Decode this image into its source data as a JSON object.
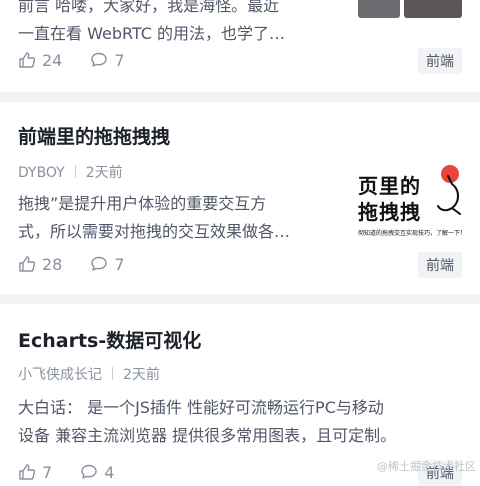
{
  "articles": [
    {
      "excerpt_lines": [
        "前言 哈喽，大家好，我是海怪。最近",
        "一直在看 WebRTC 的用法，也学了…"
      ],
      "likes": "24",
      "comments": "7",
      "tag": "前端"
    },
    {
      "title": "前端里的拖拖拽拽",
      "author": "DYBOY",
      "time": "2天前",
      "excerpt_lines": [
        "拖拽”是提升用户体验的重要交互方",
        "式，所以需要对拖拽的交互效果做各…"
      ],
      "likes": "28",
      "comments": "7",
      "tag": "前端",
      "cover": {
        "line1": "页里的",
        "line2": "拖拽拽",
        "caption": "彻知道的拖拽交互实现技巧，了解一下！"
      }
    },
    {
      "title": "Echarts-数据可视化",
      "author": "小飞侠成长记",
      "time": "2天前",
      "excerpt_lines": [
        "大白话： 是一个JS插件 性能好可流畅运行PC与移动",
        "设备 兼容主流浏览器 提供很多常用图表，且可定制。"
      ],
      "likes": "7",
      "comments": "4",
      "tag": "前端"
    }
  ],
  "watermark": "@稀土掘金技术社区",
  "icons": {
    "like": "thumbs-up-icon",
    "comment": "comment-bubble-icon"
  },
  "colors": {
    "accent_red": "#e8453c",
    "tag_bg": "#f2f3f5"
  }
}
